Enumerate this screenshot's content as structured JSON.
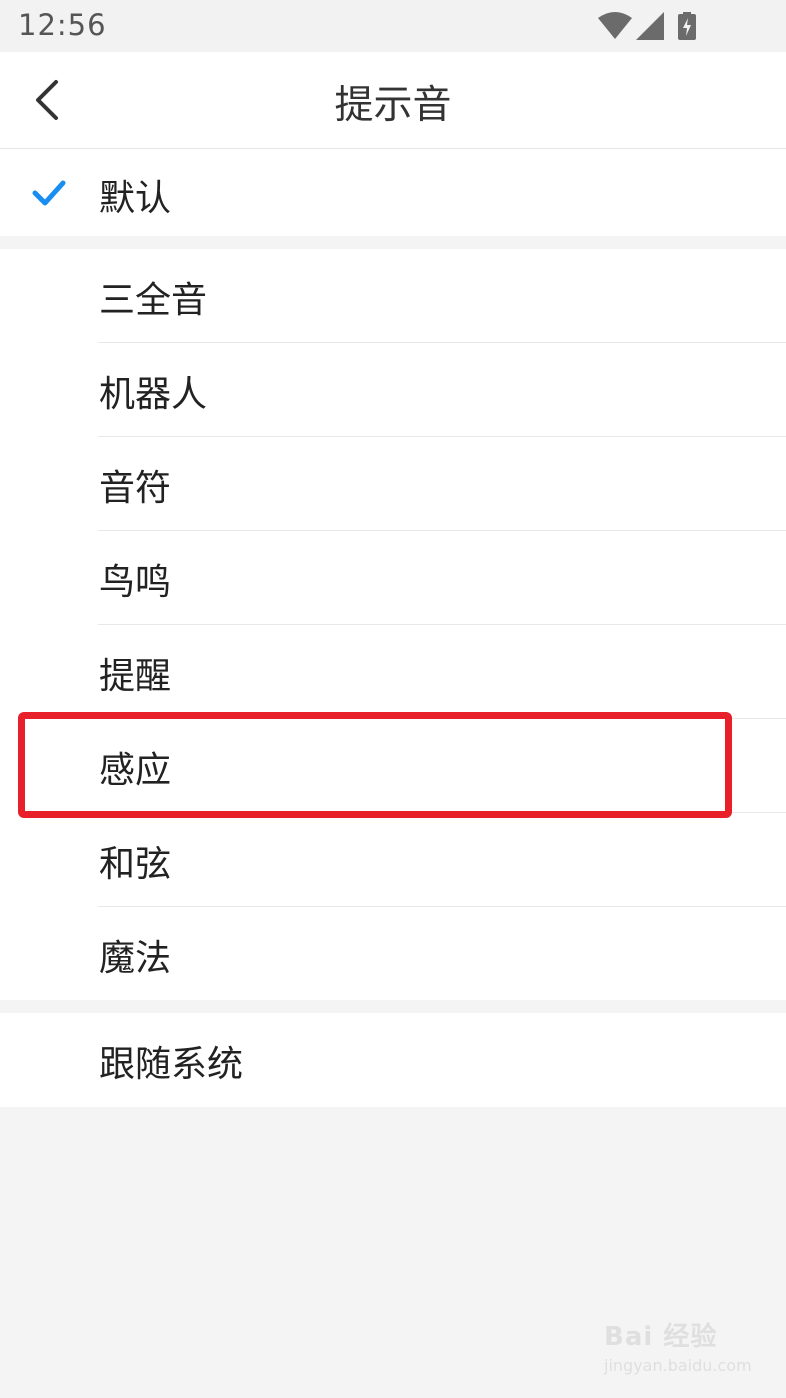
{
  "status_bar": {
    "time": "12:56",
    "icons": [
      "wifi-icon",
      "cellular-signal-icon",
      "battery-charging-icon"
    ]
  },
  "nav": {
    "title": "提示音",
    "back_icon": "back-chevron-icon"
  },
  "default_option": {
    "label": "默认",
    "selected": true,
    "check_color": "#1a8ef0"
  },
  "sounds": [
    {
      "label": "三全音"
    },
    {
      "label": "机器人"
    },
    {
      "label": "音符"
    },
    {
      "label": "鸟鸣"
    },
    {
      "label": "提醒"
    },
    {
      "label": "感应"
    },
    {
      "label": "和弦"
    },
    {
      "label": "魔法"
    }
  ],
  "follow_system": {
    "label": "跟随系统"
  },
  "highlight": {
    "target": "感应",
    "color": "#e8202a"
  },
  "watermark": {
    "main": "Bai 经验",
    "sub": "jingyan.baidu.com"
  }
}
